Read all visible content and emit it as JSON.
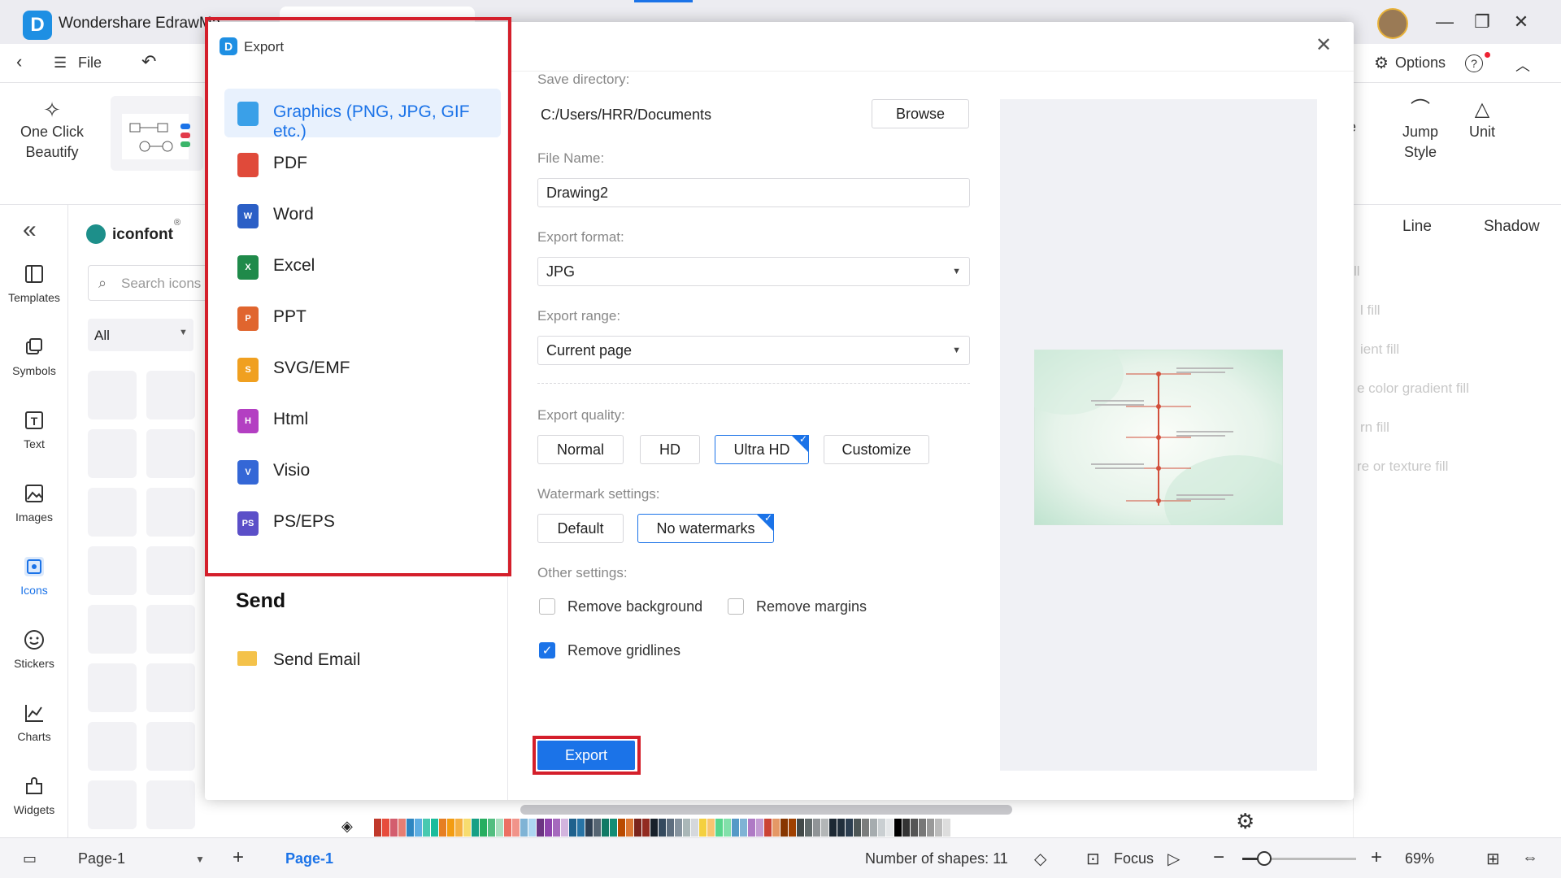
{
  "app": {
    "title": "Wondershare EdrawMa",
    "logo_letter": "D",
    "window_controls": [
      "—",
      "❐",
      "✕"
    ]
  },
  "menubar": {
    "file_label": "File",
    "options_label": "Options",
    "help_label": "?"
  },
  "ribbon": {
    "one_click_beautify": [
      "One Click",
      "Beautify"
    ],
    "page_style_partial": [
      "ge",
      "e"
    ],
    "jump_style": [
      "Jump",
      "Style"
    ],
    "unit_label": "Unit"
  },
  "left_sidebar": {
    "items": [
      {
        "label": "Templates",
        "icon": "templates-icon"
      },
      {
        "label": "Symbols",
        "icon": "symbols-icon"
      },
      {
        "label": "Text",
        "icon": "text-icon"
      },
      {
        "label": "Images",
        "icon": "images-icon"
      },
      {
        "label": "Icons",
        "icon": "icons-icon",
        "active": true
      },
      {
        "label": "Stickers",
        "icon": "stickers-icon"
      },
      {
        "label": "Charts",
        "icon": "charts-icon"
      },
      {
        "label": "Widgets",
        "icon": "widgets-icon"
      }
    ]
  },
  "symbols_panel": {
    "library_name": "iconfont",
    "search_placeholder": "Search icons",
    "filter_value": "All"
  },
  "right_panel": {
    "tabs": [
      "Line",
      "Shadow"
    ],
    "fill_options": [
      "ll",
      "l fill",
      "ient fill",
      "e color gradient fill",
      "rn fill",
      "re or texture fill"
    ]
  },
  "dialog": {
    "title": "Export",
    "formats": [
      {
        "label": "Graphics (PNG, JPG, GIF etc.)",
        "icon": "image-file-icon",
        "color": "#3aa0e8",
        "selected": true
      },
      {
        "label": "PDF",
        "icon": "pdf-file-icon",
        "color": "#e04a3a"
      },
      {
        "label": "Word",
        "icon": "word-file-icon",
        "color": "#2b5fc6"
      },
      {
        "label": "Excel",
        "icon": "excel-file-icon",
        "color": "#1f8a4a"
      },
      {
        "label": "PPT",
        "icon": "ppt-file-icon",
        "color": "#e0652e"
      },
      {
        "label": "SVG/EMF",
        "icon": "svg-file-icon",
        "color": "#f0a020"
      },
      {
        "label": "Html",
        "icon": "html-file-icon",
        "color": "#b33fc2"
      },
      {
        "label": "Visio",
        "icon": "visio-file-icon",
        "color": "#3467d6"
      },
      {
        "label": "PS/EPS",
        "icon": "ps-file-icon",
        "color": "#5b4fc8"
      }
    ],
    "format_badges": [
      "",
      "",
      "W",
      "X",
      "P",
      "S",
      "H",
      "V",
      "PS"
    ],
    "send_heading": "Send",
    "send_email_label": "Send Email",
    "save_directory_label": "Save directory:",
    "save_directory_value": "C:/Users/HRR/Documents",
    "browse_label": "Browse",
    "file_name_label": "File Name:",
    "file_name_value": "Drawing2",
    "export_format_label": "Export format:",
    "export_format_value": "JPG",
    "export_range_label": "Export range:",
    "export_range_value": "Current page",
    "export_quality_label": "Export quality:",
    "quality_options": [
      "Normal",
      "HD",
      "Ultra HD",
      "Customize"
    ],
    "quality_selected": "Ultra HD",
    "watermark_label": "Watermark settings:",
    "watermark_options": [
      "Default",
      "No watermarks"
    ],
    "watermark_selected": "No watermarks",
    "other_settings_label": "Other settings:",
    "remove_background_label": "Remove background",
    "remove_background_checked": false,
    "remove_margins_label": "Remove margins",
    "remove_margins_checked": false,
    "remove_gridlines_label": "Remove gridlines",
    "remove_gridlines_checked": true,
    "export_button_label": "Export",
    "highlight_color": "#d41f2b",
    "accent_color": "#1b73e8"
  },
  "statusbar": {
    "page_select": "Page-1",
    "active_page_tab": "Page-1",
    "shape_count": "Number of shapes: 11",
    "focus_label": "Focus",
    "zoom": "69%"
  }
}
